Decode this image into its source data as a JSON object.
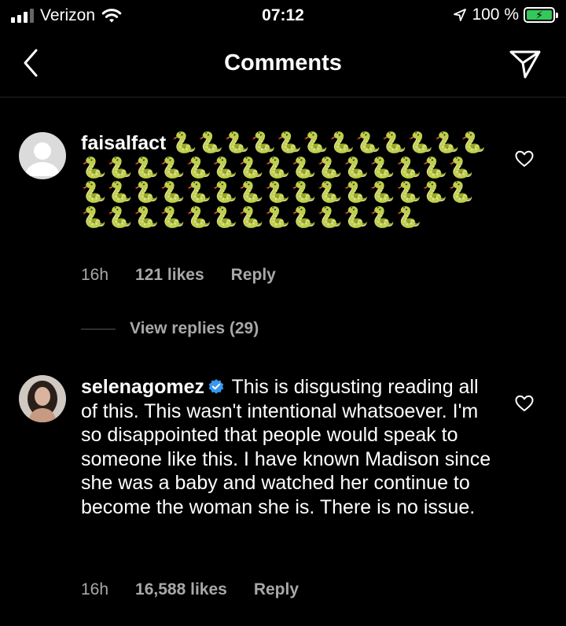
{
  "status_bar": {
    "carrier": "Verizon",
    "time": "07:12",
    "battery_percent": "100 %",
    "battery_level": 1.0
  },
  "nav": {
    "title": "Comments",
    "back_icon": "chevron-left-icon",
    "send_icon": "paper-plane-icon"
  },
  "comments": [
    {
      "username": "faisalfact",
      "text": "🐍🐍🐍🐍🐍🐍🐍🐍🐍🐍🐍🐍🐍🐍🐍🐍🐍🐍🐍🐍🐍🐍🐍🐍🐍🐍🐍🐍🐍🐍🐍🐍🐍🐍🐍🐍🐍🐍🐍🐍🐍🐍🐍🐍🐍🐍🐍🐍🐍🐍🐍🐍🐍🐍🐍",
      "time": "16h",
      "likes": "121 likes",
      "reply": "Reply",
      "view_replies": "View replies (29)"
    },
    {
      "username": "selenagomez",
      "text": "This is disgusting reading all of this. This wasn't intentional whatsoever. I'm so disappointed that people would speak to someone like this. I have known Madison since she was a baby and watched her continue to become the woman she is. There is no issue.",
      "time": "16h",
      "likes": "16,588 likes",
      "reply": "Reply"
    }
  ],
  "colors": {
    "background": "#000000",
    "secondary_text": "#a8a8a8",
    "verified_blue": "#3897f0",
    "battery_green": "#34c759"
  }
}
